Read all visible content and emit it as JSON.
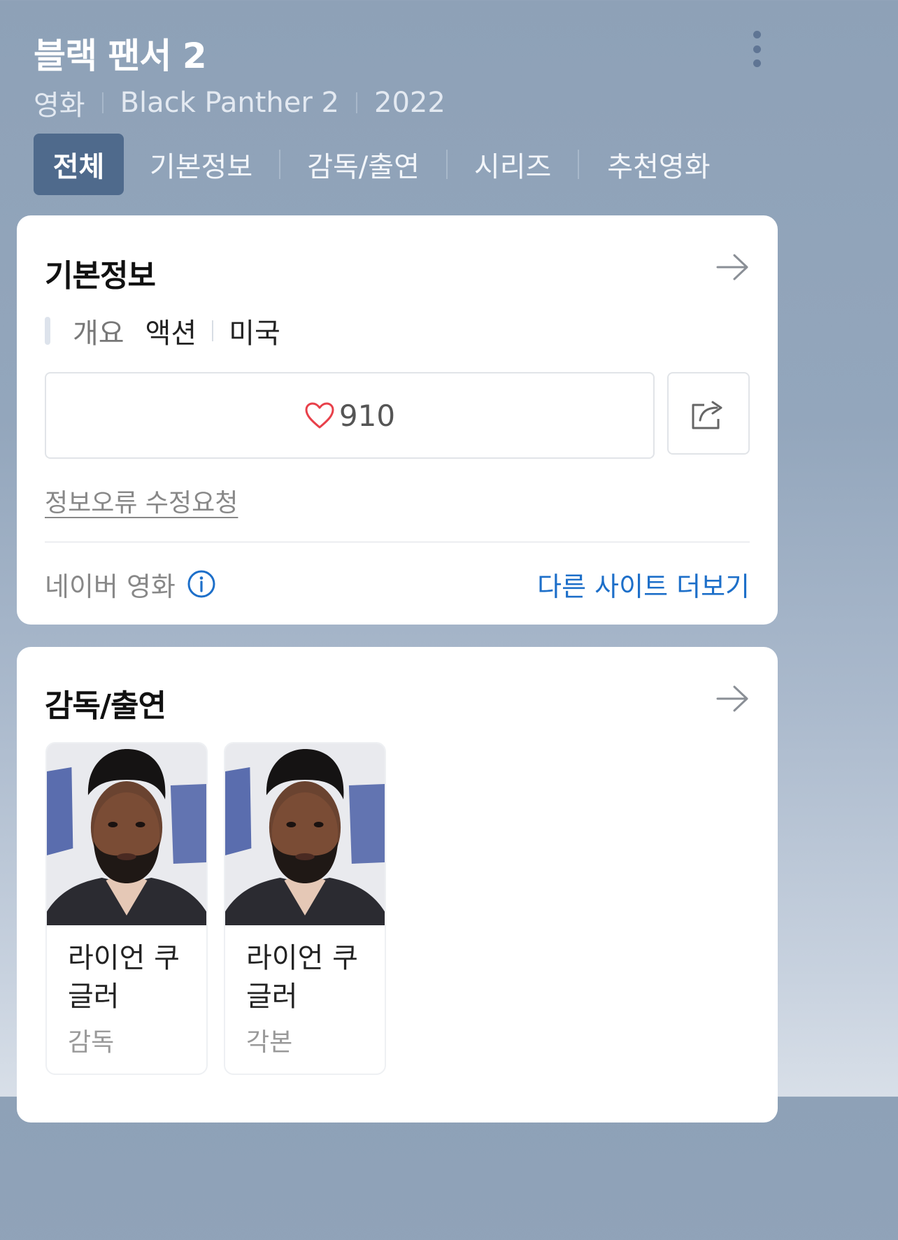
{
  "header": {
    "title": "블랙 팬서 2",
    "meta": {
      "category": "영화",
      "original_title": "Black Panther 2",
      "year": "2022"
    },
    "tabs": [
      {
        "label": "전체",
        "active": true
      },
      {
        "label": "기본정보",
        "active": false
      },
      {
        "label": "감독/출연",
        "active": false
      },
      {
        "label": "시리즈",
        "active": false
      },
      {
        "label": "추천영화",
        "active": false
      }
    ]
  },
  "basic_info": {
    "title": "기본정보",
    "overview_label": "개요",
    "genre": "액션",
    "country": "미국",
    "likes": "910",
    "report_link": "정보오류 수정요청",
    "source": "네이버 영화",
    "other_sites_link": "다른 사이트 더보기"
  },
  "cast": {
    "title": "감독/출연",
    "people": [
      {
        "name": "라이언 쿠글러",
        "role": "감독"
      },
      {
        "name": "라이언 쿠글러",
        "role": "각본"
      }
    ]
  },
  "colors": {
    "header_bg": "#8ea1b7",
    "active_tab": "#4f6a8c",
    "link_blue": "#1d6fc9",
    "heart": "#e8404a"
  },
  "icons": [
    "more-vertical-icon",
    "arrow-right-icon",
    "heart-icon",
    "share-icon",
    "info-icon"
  ]
}
